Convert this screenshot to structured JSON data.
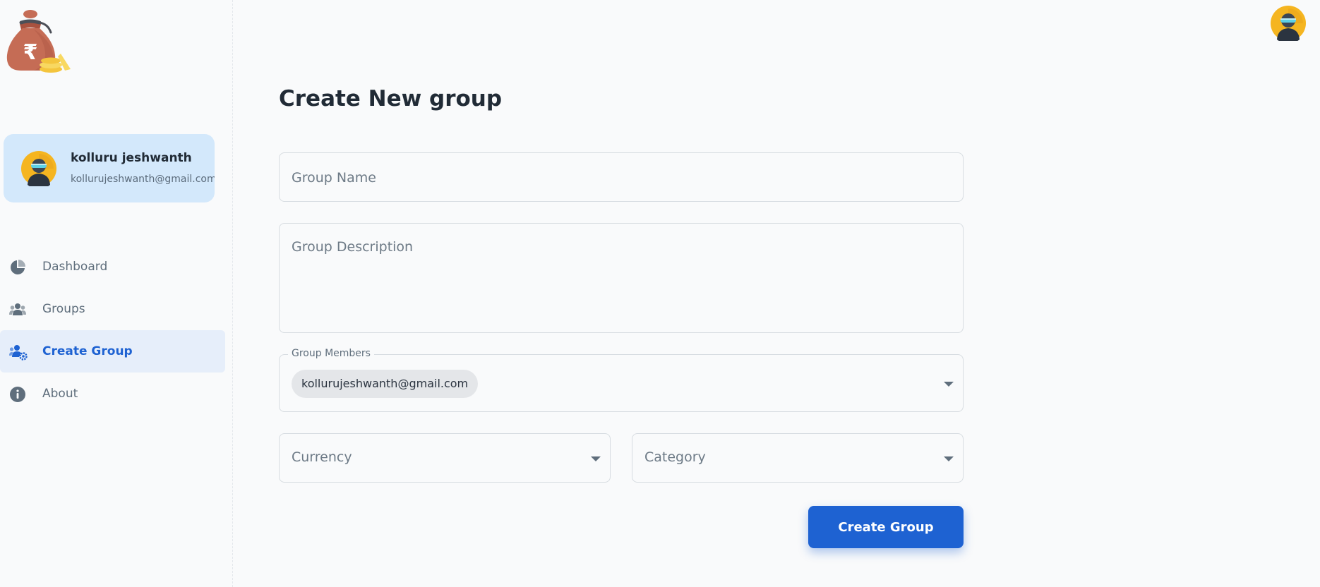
{
  "sidebar": {
    "logo_icon": "money-bag-rupee-icon",
    "user": {
      "name": "kolluru jeshwanth",
      "email": "kollurujeshwanth@gmail.com",
      "avatar_icon": "user-avatar-icon"
    },
    "items": [
      {
        "label": "Dashboard",
        "icon": "pie-chart-icon",
        "active": false
      },
      {
        "label": "Groups",
        "icon": "users-icon",
        "active": false
      },
      {
        "label": "Create Group",
        "icon": "users-gear-icon",
        "active": true
      },
      {
        "label": "About",
        "icon": "info-icon",
        "active": false
      }
    ]
  },
  "header": {
    "avatar_icon": "user-avatar-icon"
  },
  "main": {
    "title": "Create New group",
    "group_name": {
      "placeholder": "Group Name",
      "value": ""
    },
    "group_description": {
      "placeholder": "Group Description",
      "value": ""
    },
    "group_members": {
      "label": "Group Members",
      "selected": [
        "kollurujeshwanth@gmail.com"
      ]
    },
    "currency": {
      "label": "Currency"
    },
    "category": {
      "label": "Category"
    },
    "submit_label": "Create Group"
  },
  "colors": {
    "accent": "#1e62d2",
    "user_card_bg": "#d3e8fb",
    "active_nav_bg": "#e6eefa",
    "page_bg": "#f9fafb"
  }
}
